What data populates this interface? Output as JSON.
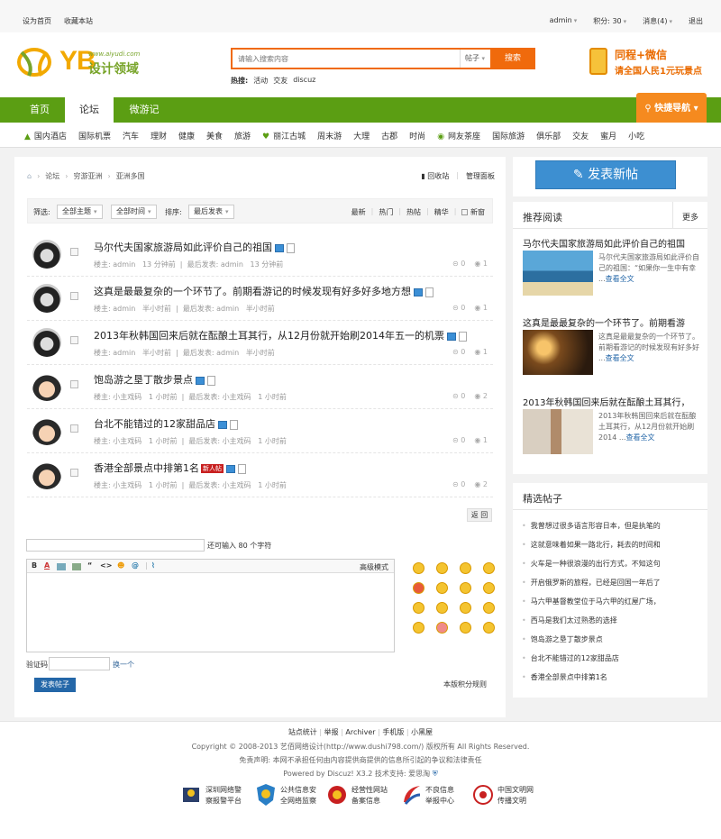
{
  "topbar": {
    "set_home": "设为首页",
    "bookmark": "收藏本站",
    "user": "admin",
    "credits": "积分: 30",
    "messages": "消息(4)",
    "logout": "退出"
  },
  "header": {
    "logo_letters": "YB",
    "logo_url": "www.aiyudi.com",
    "logo_cn": "设计领域",
    "search_placeholder": "请输入搜索内容",
    "search_type": "帖子",
    "search_button": "搜索",
    "hot_label": "热搜:",
    "hot_items": [
      "活动",
      "交友",
      "discuz"
    ],
    "promo_line1": "同程+微信",
    "promo_line2": "请全国人民1元玩景点"
  },
  "nav": {
    "tabs": [
      "首页",
      "论坛",
      "微游记"
    ],
    "active": 1,
    "quick_nav": "快捷导航"
  },
  "subnav": [
    "国内酒店",
    "国际机票",
    "汽车",
    "理财",
    "健康",
    "美食",
    "旅游",
    "丽江古城",
    "周末游",
    "大理",
    "古郡",
    "时尚",
    "网友茶座",
    "国际旅游",
    "俱乐部",
    "交友",
    "蜜月",
    "小吃"
  ],
  "breadcrumb": {
    "items": [
      "论坛",
      "穷游亚洲",
      "亚洲多国"
    ],
    "recycle": "回收站",
    "manage": "管理面板"
  },
  "filter": {
    "label": "筛选:",
    "topic": "全部主题",
    "time": "全部时间",
    "sort_label": "排序:",
    "sort": "最后发表",
    "options": [
      "最新",
      "热门",
      "热帖",
      "精华"
    ],
    "new_window": "新窗"
  },
  "threads": [
    {
      "title": "马尔代夫国家旅游局如此评价自己的祖国",
      "author_label": "楼主:",
      "author": "admin",
      "time": "13 分钟前",
      "last_label": "最后发表:",
      "last_user": "admin",
      "last_time": "13 分钟前",
      "replies": "0",
      "views": "1",
      "tag": ""
    },
    {
      "title": "这真是最最复杂的一个环节了。前期看游记的时候发现有好多好多地方想",
      "author_label": "楼主:",
      "author": "admin",
      "time": "半小时前",
      "last_label": "最后发表:",
      "last_user": "admin",
      "last_time": "半小时前",
      "replies": "0",
      "views": "1",
      "tag": ""
    },
    {
      "title": "2013年秋韩国回来后就在酝酿土耳其行，从12月份就开始刷2014年五一的机票",
      "author_label": "楼主:",
      "author": "admin",
      "time": "半小时前",
      "last_label": "最后发表:",
      "last_user": "admin",
      "last_time": "半小时前",
      "replies": "0",
      "views": "1",
      "tag": ""
    },
    {
      "title": "饱岛游之垦丁散步景点",
      "author_label": "楼主:",
      "author": "小主戏码",
      "time": "1 小时前",
      "last_label": "最后发表:",
      "last_user": "小主戏码",
      "last_time": "1 小时前",
      "replies": "0",
      "views": "2",
      "tag": ""
    },
    {
      "title": "台北不能错过的12家甜品店",
      "author_label": "楼主:",
      "author": "小主戏码",
      "time": "1 小时前",
      "last_label": "最后发表:",
      "last_user": "小主戏码",
      "last_time": "1 小时前",
      "replies": "0",
      "views": "1",
      "tag": ""
    },
    {
      "title": "香港全部景点中排第1名",
      "author_label": "楼主:",
      "author": "小主戏码",
      "time": "1 小时前",
      "last_label": "最后发表:",
      "last_user": "小主戏码",
      "last_time": "1 小时前",
      "replies": "0",
      "views": "2",
      "tag": "新人帖"
    }
  ],
  "return_btn": "返 回",
  "reply": {
    "remain": "还可输入 80 个字符",
    "advanced": "高级模式",
    "captcha_label": "验证码",
    "captcha_switch": "换一个",
    "post_button": "发表帖子",
    "credit_rules": "本版积分规则"
  },
  "sidebar": {
    "new_post": "发表新帖",
    "recommend_title": "推荐阅读",
    "recommend_more": "更多",
    "recommend": [
      {
        "title": "马尔代夫国家旅游局如此评价自己的祖国",
        "desc": "马尔代夫国家旅游局如此评价自己的祖国：“如果你一生中有幸 ...",
        "more": "查看全文"
      },
      {
        "title": "这真是最最复杂的一个环节了。前期看游",
        "desc": "这真是最最复杂的一个环节了。前期看游记的时候发现有好多好 ...",
        "more": "查看全文"
      },
      {
        "title": "2013年秋韩国回来后就在酝酿土耳其行，",
        "desc": "2013年秋韩国回来后就在酝酿土耳其行，从12月份就开始刷2014 ...",
        "more": "查看全文"
      }
    ],
    "picks_title": "精选帖子",
    "picks": [
      "我曾想过很多语言形容日本，但是执笔的",
      "这就意味着如果一路北行，耗去的时间和",
      "火车是一种很浪漫的出行方式，不知这句",
      "开启俄罗斯的旅程，已经是回国一年后了",
      "马六甲基督教堂位于马六甲的红屋广场，",
      "西马是我们太过熟悉的选择",
      "饱岛游之垦丁散步景点",
      "台北不能错过的12家甜品店",
      "香港全部景点中排第1名"
    ]
  },
  "footer": {
    "links": [
      "站点统计",
      "举报",
      "Archiver",
      "手机版",
      "小黑屋"
    ],
    "copyright": "Copyright © 2008-2013 艺佰网络设计(http://www.dushi798.com/) 版权所有 All Rights Reserved.",
    "disclaimer": "免责声明: 本网不承担任何由内容提供商提供的信息所引起的争议和法律责任",
    "powered": "Powered by Discuz! X3.2  技术支持: 爱思淘",
    "badges": [
      {
        "l1": "深圳网络警",
        "l2": "察报警平台"
      },
      {
        "l1": "公共信息安",
        "l2": "全网络监察"
      },
      {
        "l1": "经营性网站",
        "l2": "备案信息"
      },
      {
        "l1": "不良信息",
        "l2": "举报中心"
      },
      {
        "l1": "中国文明网",
        "l2": "传播文明"
      }
    ]
  },
  "colors": {
    "accent_green": "#5b9e13",
    "accent_orange": "#f06a0c",
    "link_blue": "#2467a8",
    "button_blue": "#3d8fd1"
  }
}
